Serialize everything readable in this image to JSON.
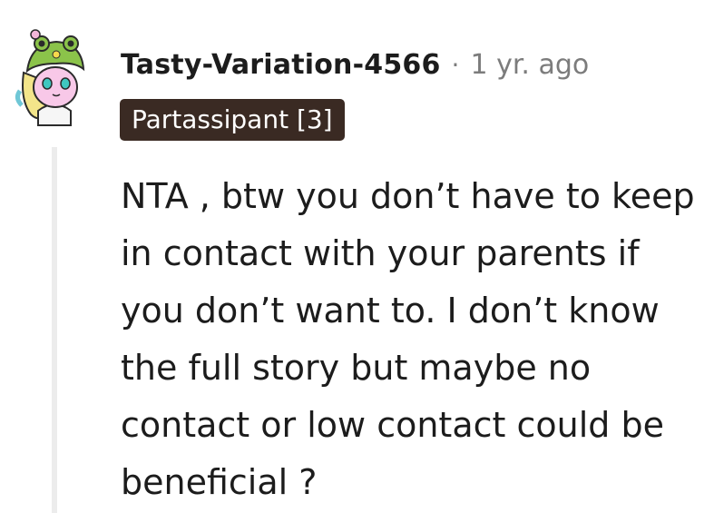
{
  "comment": {
    "username": "Tasty-Variation-4566",
    "separator": "·",
    "timestamp": "1 yr. ago",
    "flair": "Partassipant [3]",
    "body": "NTA , btw you don’t have to keep in contact with your parents if you don’t want to. I don’t know the full story but maybe no contact or low contact could be beneficial ?",
    "avatar_icon": "frog-hat-avatar-icon"
  },
  "colors": {
    "flair_background": "#3a2a23",
    "flair_text": "#ffffff",
    "muted_text": "#7c7c7c",
    "thread_line": "#ececec",
    "avatar_hat": "#8bc34a",
    "avatar_face": "#f8c8e8"
  }
}
